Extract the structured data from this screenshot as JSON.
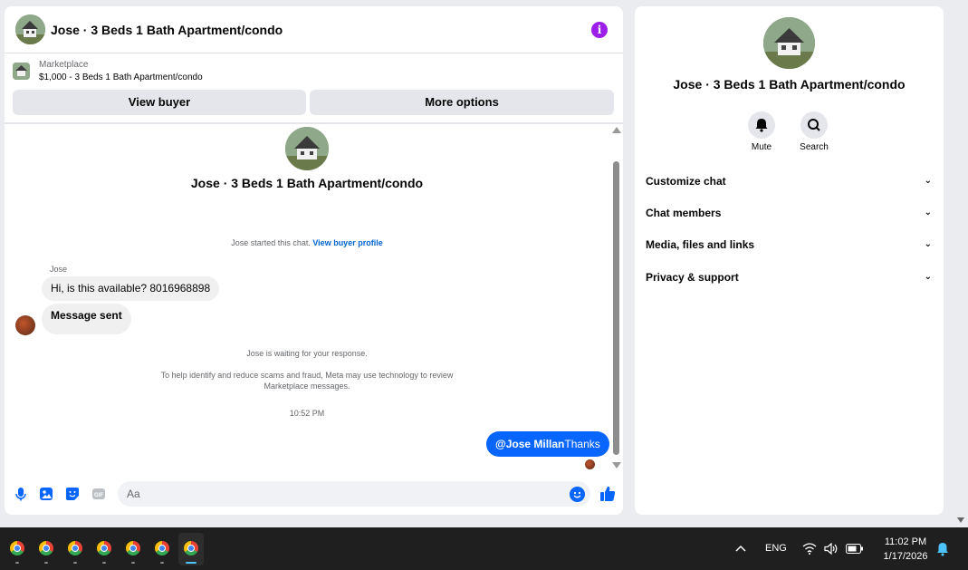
{
  "chat": {
    "title": "Jose · 3 Beds 1 Bath Apartment/condo",
    "marketplace_label": "Marketplace",
    "listing": "$1,000 - 3 Beds 1 Bath Apartment/condo",
    "view_buyer": "View buyer",
    "more_options": "More options",
    "convo_title": "Jose · 3 Beds 1 Bath Apartment/condo",
    "started_text": "Jose started this chat.",
    "view_buyer_profile": "View buyer profile",
    "sender_name": "Jose",
    "messages_in": [
      "Hi, is this available? 8016968898",
      "Message sent"
    ],
    "waiting_text": "Jose is waiting for your response.",
    "scam_notice_1": "To help identify and reduce scams and fraud, Meta may use technology to review",
    "scam_notice_2": "Marketplace messages.",
    "time": "10:52 PM",
    "out_mention": "@Jose Millan",
    "out_text": "Thanks",
    "input_placeholder": "Aa"
  },
  "info_panel": {
    "title": "Jose · 3 Beds 1 Bath Apartment/condo",
    "mute": "Mute",
    "search": "Search",
    "menu": [
      "Customize chat",
      "Chat members",
      "Media, files and links",
      "Privacy & support"
    ]
  },
  "taskbar": {
    "language": "ENG",
    "time": "11:02 PM",
    "date": "1/17/2026",
    "app_count": 7
  },
  "colors": {
    "accent": "#0866ff",
    "info_icon": "#9b1fe8"
  }
}
